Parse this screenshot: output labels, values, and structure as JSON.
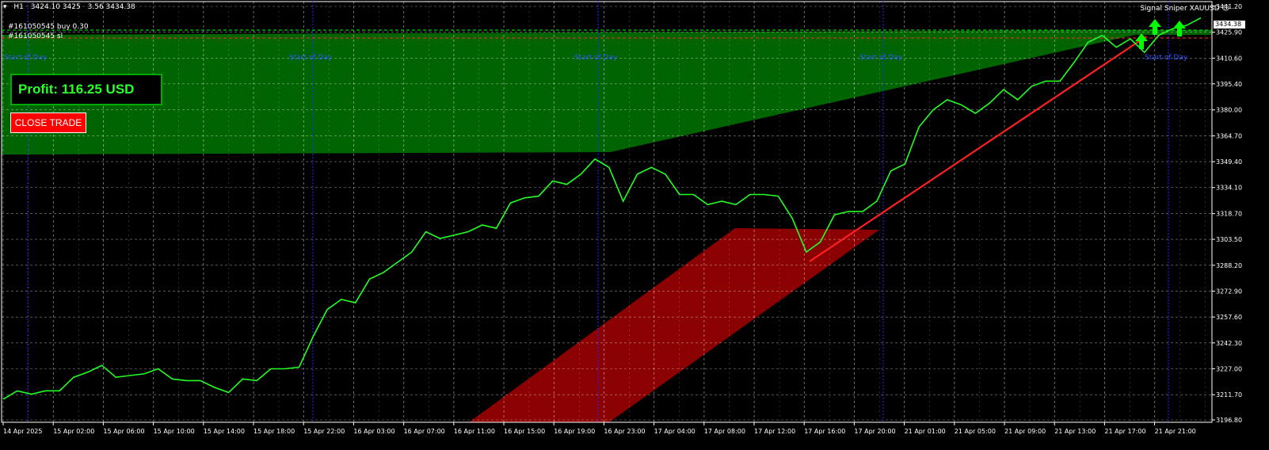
{
  "header": {
    "symbol_menu_icon": "triangle-down-icon",
    "timeframe": "H1",
    "ohlc_text": "3424.10 3425",
    "change_text": "3.56 3434.38"
  },
  "orders": {
    "buy_label": "#161050545 buy 0.30",
    "sl_label": "#161050545 sl"
  },
  "indicator": {
    "name": "Signal Sniper XAUUSD",
    "smiley_icon": "smiley-icon"
  },
  "trade_panel": {
    "profit_text": "Profit: 116.25 USD",
    "close_button_label": "CLOSE TRADE"
  },
  "current_price": "3434.38",
  "price_scale": [
    "3441.20",
    "3425.90",
    "3410.60",
    "3395.40",
    "3380.00",
    "3364.70",
    "3349.40",
    "3334.10",
    "3318.70",
    "3303.50",
    "3288.20",
    "3272.90",
    "3257.60",
    "3242.30",
    "3227.00",
    "3211.70",
    "3196.80"
  ],
  "time_scale": [
    "14 Apr 2025",
    "15 Apr 02:00",
    "15 Apr 06:00",
    "15 Apr 10:00",
    "15 Apr 14:00",
    "15 Apr 18:00",
    "15 Apr 22:00",
    "16 Apr 03:00",
    "16 Apr 07:00",
    "16 Apr 11:00",
    "16 Apr 15:00",
    "16 Apr 19:00",
    "16 Apr 23:00",
    "17 Apr 04:00",
    "17 Apr 08:00",
    "17 Apr 12:00",
    "17 Apr 16:00",
    "17 Apr 20:00",
    "21 Apr 01:00",
    "21 Apr 05:00",
    "21 Apr 09:00",
    "21 Apr 13:00",
    "21 Apr 17:00",
    "21 Apr 21:00"
  ],
  "start_of_day_label": "Start of Day",
  "colors": {
    "price_line": "#22ff22",
    "trend_line": "#ff2020",
    "green_zone": "#006400",
    "red_zone": "#8b0000",
    "grid": "#ffffff",
    "separator": "#2a2aff",
    "arrow": "#00ff00"
  },
  "chart_data": {
    "type": "line",
    "close_prices": [
      3209,
      3214,
      3212,
      3214,
      3214,
      3222,
      3225,
      3229,
      3222,
      3223,
      3224,
      3227,
      3221,
      3220,
      3220,
      3216,
      3213,
      3221,
      3220,
      3227,
      3227,
      3228,
      3246,
      3262,
      3268,
      3266,
      3280,
      3284,
      3290,
      3296,
      3308,
      3304,
      3306,
      3308,
      3312,
      3310,
      3325,
      3328,
      3329,
      3338,
      3336,
      3342,
      3351,
      3346,
      3326,
      3342,
      3346,
      3342,
      3330,
      3330,
      3324,
      3326,
      3324,
      3330,
      3330,
      3329,
      3316,
      3296,
      3302,
      3318,
      3320,
      3320,
      3326,
      3344,
      3348,
      3370,
      3380,
      3386,
      3383,
      3378,
      3384,
      3392,
      3386,
      3394,
      3397,
      3397,
      3408,
      3420,
      3424,
      3417,
      3422,
      3414,
      3424,
      3428,
      3430,
      3434.38
    ],
    "ylim": [
      3196.8,
      3441.2
    ]
  }
}
